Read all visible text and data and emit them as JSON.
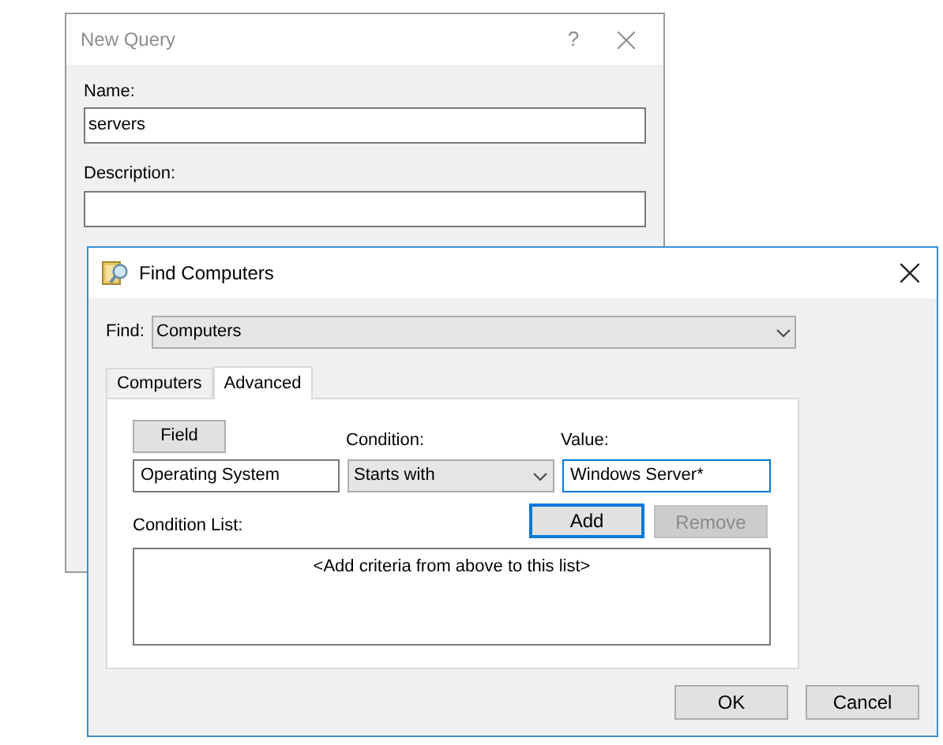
{
  "back_window": {
    "title": "New Query",
    "help": "?",
    "name_label": "Name:",
    "name_value": "servers",
    "description_label": "Description:"
  },
  "dialog": {
    "title": "Find Computers",
    "find_label": "Find:",
    "find_value": "Computers",
    "tabs": [
      {
        "label": "Computers",
        "selected": false
      },
      {
        "label": "Advanced",
        "selected": true
      }
    ],
    "field_button": "Field",
    "condition_label": "Condition:",
    "value_label": "Value:",
    "field_value": "Operating System",
    "condition_value": "Starts with",
    "value_value": "Windows Server*",
    "add_button": {
      "label": "Add",
      "disabled": false,
      "focused": true
    },
    "remove_button": {
      "label": "Remove",
      "disabled": true,
      "focused": false
    },
    "condition_list_label": "Condition List:",
    "condition_list_placeholder": "<Add criteria from above to this list>",
    "ok": "OK",
    "cancel": "Cancel"
  }
}
